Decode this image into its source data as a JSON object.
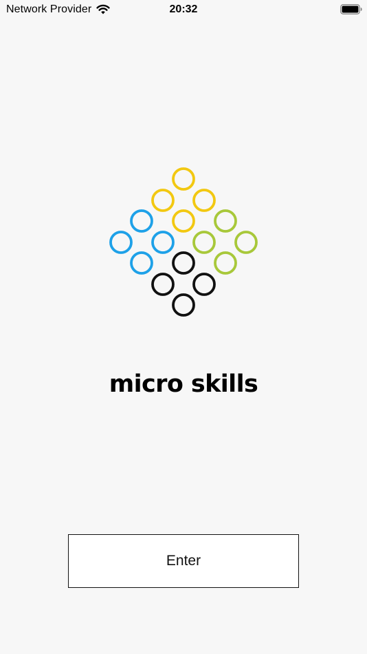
{
  "status_bar": {
    "carrier": "Network Provider",
    "time": "20:32",
    "wifi_icon": "wifi-icon",
    "battery_icon": "battery-icon"
  },
  "brand": {
    "name": "micro skills",
    "logo_icon": "dot-grid-logo-icon",
    "colors": {
      "yellow": "#f2c811",
      "blue": "#1ea1e8",
      "green": "#a8c83a",
      "black": "#111111"
    }
  },
  "actions": {
    "enter_label": "Enter"
  }
}
